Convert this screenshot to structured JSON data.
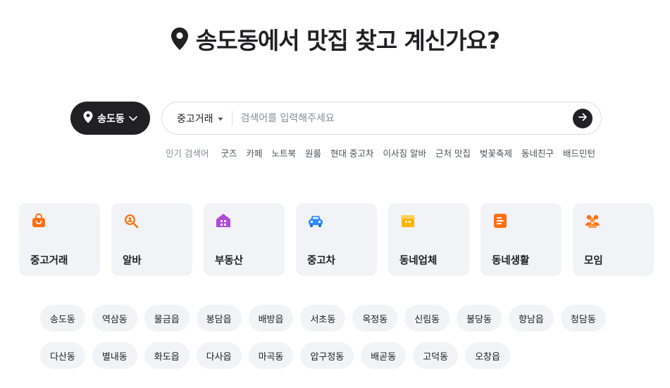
{
  "hero": {
    "title": "송도동에서 맛집 찾고 계신가요?"
  },
  "location_button": {
    "label": "송도동"
  },
  "search": {
    "category": "중고거래",
    "placeholder": "검색어를 입력해주세요"
  },
  "popular": {
    "label": "인기 검색어",
    "keywords": [
      "굿즈",
      "카페",
      "노트북",
      "원룸",
      "현대 중고차",
      "이사짐 알바",
      "근처 맛집",
      "벚꽃축제",
      "동네친구",
      "배드민턴"
    ]
  },
  "categories": [
    {
      "label": "중고거래",
      "icon": "shopping-bag-icon",
      "color": "#ff6f0f"
    },
    {
      "label": "알바",
      "icon": "search-person-icon",
      "color": "#ff6f0f"
    },
    {
      "label": "부동산",
      "icon": "house-icon",
      "color": "#b04ad6"
    },
    {
      "label": "중고차",
      "icon": "car-icon",
      "color": "#2f8cff"
    },
    {
      "label": "동네업체",
      "icon": "store-icon",
      "color": "#ffb400"
    },
    {
      "label": "동네생활",
      "icon": "note-icon",
      "color": "#ff6f0f"
    },
    {
      "label": "모임",
      "icon": "group-icon",
      "color": "#ff6f0f"
    }
  ],
  "neighborhoods": [
    "송도동",
    "역삼동",
    "물금읍",
    "봉담읍",
    "배방읍",
    "서초동",
    "옥정동",
    "신림동",
    "불당동",
    "향남읍",
    "청담동",
    "다산동",
    "별내동",
    "화도읍",
    "다사읍",
    "마곡동",
    "압구정동",
    "배곧동",
    "고덕동",
    "오창읍"
  ],
  "colors": {
    "dark": "#212124",
    "chip_bg": "#f2f3f6",
    "accent": "#ff6f0f"
  }
}
